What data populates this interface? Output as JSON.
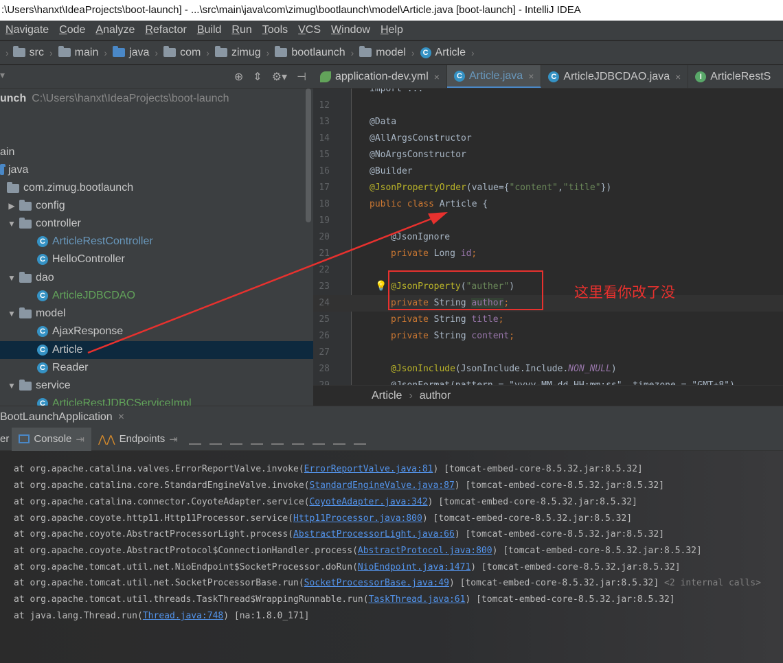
{
  "window": {
    "title": ":\\Users\\hanxt\\IdeaProjects\\boot-launch] - ...\\src\\main\\java\\com\\zimug\\bootlaunch\\model\\Article.java [boot-launch] - IntelliJ IDEA"
  },
  "menu": [
    "Navigate",
    "Code",
    "Analyze",
    "Refactor",
    "Build",
    "Run",
    "Tools",
    "VCS",
    "Window",
    "Help"
  ],
  "breadcrumb": [
    "src",
    "main",
    "java",
    "com",
    "zimug",
    "bootlaunch",
    "model",
    "Article"
  ],
  "project": {
    "root_label": "unch",
    "root_path": "C:\\Users\\hanxt\\IdeaProjects\\boot-launch",
    "items": [
      {
        "label": "ain"
      },
      {
        "label": "java"
      },
      {
        "label": "com.zimug.bootlaunch"
      },
      {
        "label": "config"
      },
      {
        "label": "controller"
      },
      {
        "label": "ArticleRestController"
      },
      {
        "label": "HelloController"
      },
      {
        "label": "dao"
      },
      {
        "label": "ArticleJDBCDAO"
      },
      {
        "label": "model"
      },
      {
        "label": "AjaxResponse"
      },
      {
        "label": "Article"
      },
      {
        "label": "Reader"
      },
      {
        "label": "service"
      },
      {
        "label": "ArticleRestJDBCServiceImpl"
      }
    ]
  },
  "tabs": [
    "application-dev.yml",
    "Article.java",
    "ArticleJDBCDAO.java",
    "ArticleRestS"
  ],
  "code": {
    "top_fragment": "import ...",
    "lines": [
      {
        "n": "12"
      },
      {
        "n": "13"
      },
      {
        "n": "14"
      },
      {
        "n": "15"
      },
      {
        "n": "16"
      },
      {
        "n": "17"
      },
      {
        "n": "18"
      },
      {
        "n": "19"
      },
      {
        "n": "20"
      },
      {
        "n": "21"
      },
      {
        "n": "22"
      },
      {
        "n": "23"
      },
      {
        "n": "24"
      },
      {
        "n": "25"
      },
      {
        "n": "26"
      },
      {
        "n": "27"
      },
      {
        "n": "28"
      },
      {
        "n": "29"
      }
    ],
    "t_data": "@Data",
    "t_all": "@AllArgsConstructor",
    "t_no": "@NoArgsConstructor",
    "t_builder": "@Builder",
    "t_jpo": "@JsonPropertyOrder",
    "t_jpo_args_a": "(value={",
    "t_jpo_content": "\"content\"",
    "t_comma": ",",
    "t_jpo_title": "\"title\"",
    "t_jpo_end": "})",
    "t_public": "public class",
    "t_classname": " Article {",
    "t_ignore": "@JsonIgnore",
    "t_private": "private",
    "t_long": " Long ",
    "t_id": "id",
    "t_semi": ";",
    "t_jp": "@JsonProperty",
    "t_jp_open": "(",
    "t_jp_val": "\"auther\"",
    "t_jp_close": ")",
    "t_string": " String ",
    "t_author": "author",
    "t_title": "title",
    "t_content": "content",
    "t_include": "@JsonInclude",
    "t_include_a": "(JsonInclude.Include.",
    "t_nonnull": "NON_NULL",
    "t_include_b": ")",
    "t_format": "@JsonFormat(pattern = \"yyyy-MM-dd HH:mm:ss\", timezone = \"GMT+8\")"
  },
  "editor_crumbs": [
    "Article",
    "author"
  ],
  "note": "这里看你改了没",
  "run": {
    "title": "BootLaunchApplication",
    "tab_prev": "er",
    "tab_console": "Console",
    "tab_endpoints": "Endpoints"
  },
  "console": [
    {
      "pre": "at org.apache.catalina.valves.ErrorReportValve.invoke(",
      "link": "ErrorReportValve.java:81",
      "post": ") [tomcat-embed-core-8.5.32.jar:8.5.32]",
      "extra": ""
    },
    {
      "pre": "at org.apache.catalina.core.StandardEngineValve.invoke(",
      "link": "StandardEngineValve.java:87",
      "post": ") [tomcat-embed-core-8.5.32.jar:8.5.32]",
      "extra": ""
    },
    {
      "pre": "at org.apache.catalina.connector.CoyoteAdapter.service(",
      "link": "CoyoteAdapter.java:342",
      "post": ") [tomcat-embed-core-8.5.32.jar:8.5.32]",
      "extra": ""
    },
    {
      "pre": "at org.apache.coyote.http11.Http11Processor.service(",
      "link": "Http11Processor.java:800",
      "post": ") [tomcat-embed-core-8.5.32.jar:8.5.32]",
      "extra": ""
    },
    {
      "pre": "at org.apache.coyote.AbstractProcessorLight.process(",
      "link": "AbstractProcessorLight.java:66",
      "post": ") [tomcat-embed-core-8.5.32.jar:8.5.32]",
      "extra": ""
    },
    {
      "pre": "at org.apache.coyote.AbstractProtocol$ConnectionHandler.process(",
      "link": "AbstractProtocol.java:800",
      "post": ") [tomcat-embed-core-8.5.32.jar:8.5.32]",
      "extra": ""
    },
    {
      "pre": "at org.apache.tomcat.util.net.NioEndpoint$SocketProcessor.doRun(",
      "link": "NioEndpoint.java:1471",
      "post": ") [tomcat-embed-core-8.5.32.jar:8.5.32]",
      "extra": ""
    },
    {
      "pre": "at org.apache.tomcat.util.net.SocketProcessorBase.run(",
      "link": "SocketProcessorBase.java:49",
      "post": ") [tomcat-embed-core-8.5.32.jar:8.5.32]",
      "extra": " <2 internal calls>"
    },
    {
      "pre": "at org.apache.tomcat.util.threads.TaskThread$WrappingRunnable.run(",
      "link": "TaskThread.java:61",
      "post": ") [tomcat-embed-core-8.5.32.jar:8.5.32]",
      "extra": ""
    },
    {
      "pre": "at java.lang.Thread.run(",
      "link": "Thread.java:748",
      "post": ") [na:1.8.0_171]",
      "extra": ""
    }
  ]
}
